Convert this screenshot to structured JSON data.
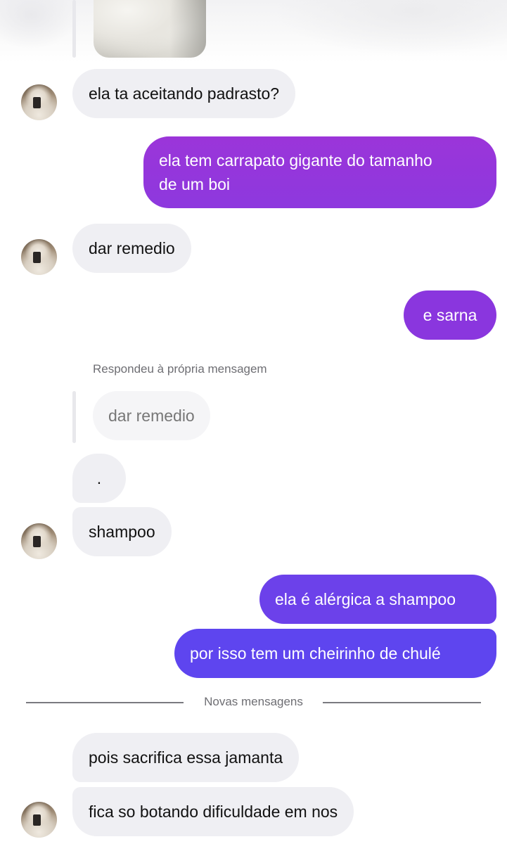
{
  "chat": {
    "messages": [
      {
        "id": "m1",
        "direction": "incoming",
        "text": "ela ta aceitando padrasto?"
      },
      {
        "id": "m2",
        "direction": "outgoing",
        "lines": [
          "ela tem carrapato gigante do tamanho",
          "de um boi"
        ]
      },
      {
        "id": "m3",
        "direction": "incoming",
        "text": "dar remedio"
      },
      {
        "id": "m4",
        "direction": "outgoing",
        "text": "e sarna"
      },
      {
        "id": "m5",
        "direction": "incoming",
        "reply_label": "Respondeu à própria mensagem",
        "quoted_text": "dar remedio",
        "text": "."
      },
      {
        "id": "m6",
        "direction": "incoming",
        "text": "shampoo"
      },
      {
        "id": "m7",
        "direction": "outgoing",
        "text": "ela é alérgica a shampoo"
      },
      {
        "id": "m8",
        "direction": "outgoing",
        "text": "por isso tem um cheirinho de chulé"
      },
      {
        "id": "m9",
        "direction": "incoming",
        "text": "pois sacrifica essa jamanta"
      },
      {
        "id": "m10",
        "direction": "incoming",
        "text": "fica so botando dificuldade em nos"
      }
    ],
    "divider_label": "Novas mensagens"
  },
  "icons": {
    "avatar": "contact-avatar",
    "shared_photo": "shared-photo-thumbnail"
  },
  "colors": {
    "incoming_bubble": "#efeff3",
    "outgoing_gradient_top": "#9b35d9",
    "outgoing_gradient_mid": "#7f3ce6",
    "outgoing_gradient_bottom": "#5d45ef",
    "meta_text": "#6e6e73"
  }
}
